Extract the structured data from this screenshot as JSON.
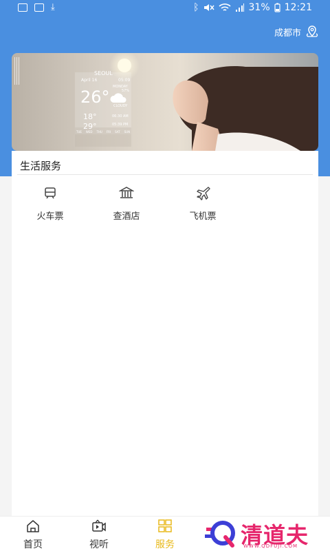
{
  "status_bar": {
    "battery": "31%",
    "time": "12:21",
    "icons": [
      "image-icon",
      "activity-icon",
      "download-icon",
      "bluetooth-icon",
      "mute-icon",
      "wifi-icon",
      "signal-icon",
      "battery-icon"
    ]
  },
  "header": {
    "location": "成都市",
    "location_icon": "map-pin-icon"
  },
  "banner": {
    "city": "SEOUL",
    "date": "April 16",
    "date_short": "05:09",
    "day": "MONDAY",
    "percent": "57%",
    "temperature": "26°",
    "condition": "CLOUDY",
    "low": "18°",
    "high": "29°",
    "sunrise": "06:30 AM",
    "sunset": "05:39 PM",
    "forecast_days": [
      "TUE",
      "WED",
      "THU",
      "FRI",
      "SAT",
      "SUN"
    ]
  },
  "services": {
    "title": "生活服务",
    "items": [
      {
        "label": "火车票",
        "icon": "train-icon"
      },
      {
        "label": "查酒店",
        "icon": "hotel-icon"
      },
      {
        "label": "飞机票",
        "icon": "airplane-icon"
      }
    ]
  },
  "bottom_nav": {
    "items": [
      {
        "label": "首页",
        "icon": "home-icon",
        "active": false
      },
      {
        "label": "视听",
        "icon": "video-icon",
        "active": false
      },
      {
        "label": "服务",
        "icon": "grid-icon",
        "active": true
      }
    ]
  },
  "watermark": {
    "text": "清道夫",
    "url": "WWW.QDFUJI.COM"
  },
  "colors": {
    "primary": "#4a8fe0",
    "active_nav": "#e8b91a",
    "watermark": "#e6266c"
  }
}
